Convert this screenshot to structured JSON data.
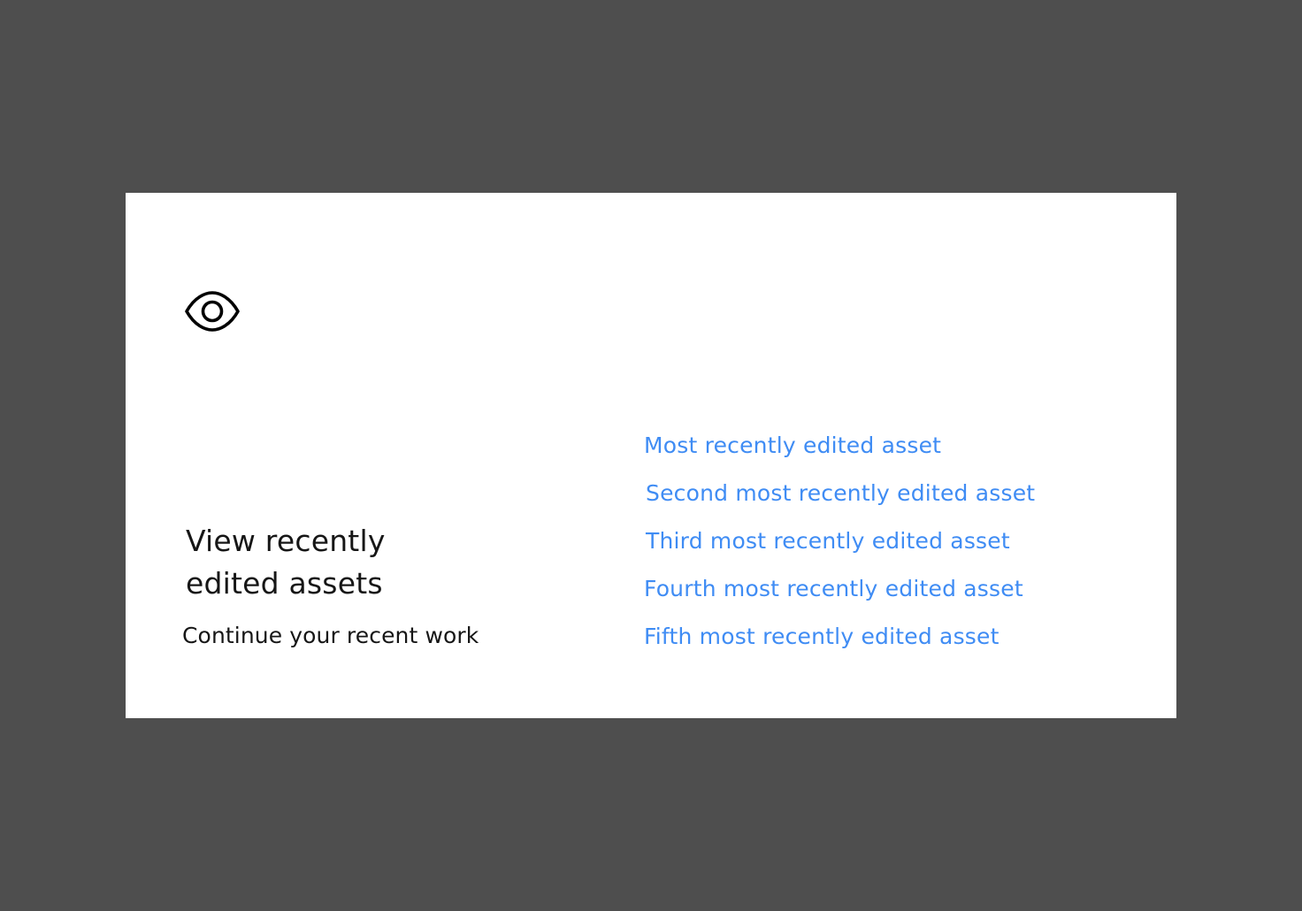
{
  "card": {
    "icon": "eye-icon",
    "title_line1": "View recently",
    "title_line2": "edited assets",
    "subtitle": "Continue your recent work",
    "links": [
      "Most recently edited asset",
      "Second most recently edited asset",
      "Third most recently edited asset",
      "Fourth most recently edited asset",
      "Fifth most recently edited asset"
    ]
  },
  "colors": {
    "background": "#4e4e4e",
    "card": "#ffffff",
    "text": "#161616",
    "link": "#3f8cf4"
  }
}
